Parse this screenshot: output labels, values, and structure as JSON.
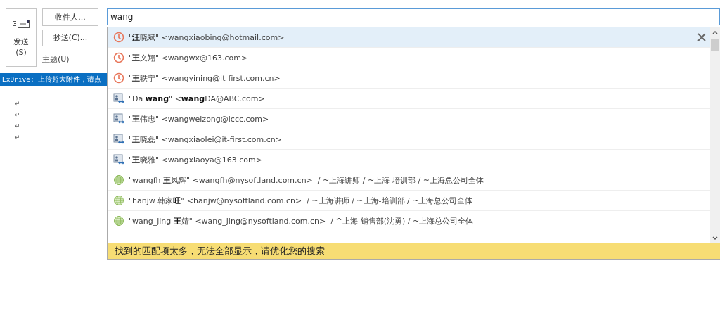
{
  "send_button": {
    "label": "发送",
    "shortcut": "(S)"
  },
  "to_button": {
    "label": "收件人..."
  },
  "cc_button": {
    "label": "抄送(C)..."
  },
  "subject_label": "主题(U)",
  "to_field": {
    "value": "wang"
  },
  "exdrive_bar": "ExDrive: 上传超大附件，请点",
  "body_marks": [
    "↵",
    "↵",
    "↵",
    "↵"
  ],
  "suggestions": [
    {
      "kind": "recent",
      "selected": true,
      "name": "\"**汪**晓斌\"",
      "email": "<wangxiaobing@hotmail.com>"
    },
    {
      "kind": "recent",
      "selected": false,
      "name": "\"**王**文翔\"",
      "email": "<wangwx@163.com>"
    },
    {
      "kind": "recent",
      "selected": false,
      "name": "\"**王**轶宁\"",
      "email": "<wangyining@it-first.com.cn>"
    },
    {
      "kind": "contact",
      "selected": false,
      "name": "\"Da **wang**\"",
      "email": "<**wang**DA@ABC.com>"
    },
    {
      "kind": "contact",
      "selected": false,
      "name": "\"**王**伟忠\"",
      "email": "<wangweizong@iccc.com>"
    },
    {
      "kind": "contact",
      "selected": false,
      "name": "\"**王**晓磊\"",
      "email": "<wangxiaolei@it-first.com.cn>"
    },
    {
      "kind": "contact",
      "selected": false,
      "name": "\"**王**晓雅\"",
      "email": "<wangxiaoya@163.com>"
    },
    {
      "kind": "directory",
      "selected": false,
      "name": "\"wangfh **王**凤辉\"",
      "email": "<wangfh@nysoftland.com.cn>",
      "path": "/ ~上海讲师 / ~上海-培训部 / ~上海总公司全体"
    },
    {
      "kind": "directory",
      "selected": false,
      "name": "\"hanjw 韩家**旺**\"",
      "email": "<hanjw@nysoftland.com.cn>",
      "path": "/ ~上海讲师 / ~上海-培训部 / ~上海总公司全体"
    },
    {
      "kind": "directory",
      "selected": false,
      "name": "\"wang_jing **王**婧\"",
      "email": "<wang_jing@nysoftland.com.cn>",
      "path": "/ ^上海-销售部(沈勇) / ~上海总公司全体"
    }
  ],
  "too_many_notice": "找到的匹配项太多，无法全部显示，请优化您的搜索"
}
